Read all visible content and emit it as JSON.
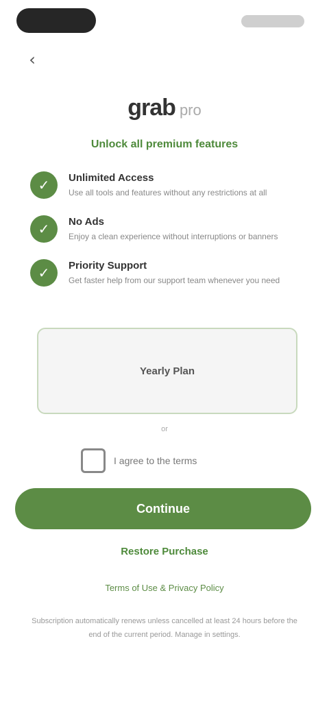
{
  "header": {
    "back_glyph": "‹"
  },
  "logo": {
    "primary": "grab",
    "secondary": "pro"
  },
  "promo": {
    "text": "Unlock all premium features"
  },
  "features": [
    {
      "title": "Unlimited Access",
      "desc": "Use all tools and features without any restrictions at all"
    },
    {
      "title": "No Ads",
      "desc": "Enjoy a clean experience without interruptions or banners"
    },
    {
      "title": "Priority Support",
      "desc": "Get faster help from our support team whenever you need"
    }
  ],
  "plan": {
    "label": "Yearly Plan"
  },
  "note": {
    "text": "or"
  },
  "consent": {
    "label": "I agree to the terms"
  },
  "cta": {
    "label": "Continue"
  },
  "links": {
    "restore": "Restore Purchase",
    "terms": "Terms of Use & Privacy Policy"
  },
  "legal": {
    "text": "Subscription automatically renews unless cancelled at least 24 hours before the end of the current period. Manage in settings."
  },
  "colors": {
    "accent": "#5c8c45",
    "accent_text": "#4e8a3b"
  }
}
